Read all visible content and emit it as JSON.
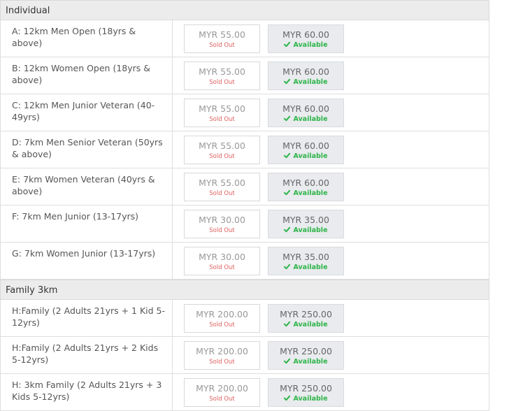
{
  "sections": [
    {
      "title": "Individual",
      "rows": [
        {
          "label": "A: 12km Men Open (18yrs & above)",
          "sold_price": "MYR 55.00",
          "sold_status": "Sold Out",
          "avail_price": "MYR 60.00",
          "avail_status": "Available"
        },
        {
          "label": "B: 12km Women Open (18yrs & above)",
          "sold_price": "MYR 55.00",
          "sold_status": "Sold Out",
          "avail_price": "MYR 60.00",
          "avail_status": "Available"
        },
        {
          "label": "C: 12km Men Junior Veteran (40-49yrs)",
          "sold_price": "MYR 55.00",
          "sold_status": "Sold Out",
          "avail_price": "MYR 60.00",
          "avail_status": "Available"
        },
        {
          "label": "D: 7km Men Senior Veteran (50yrs & above)",
          "sold_price": "MYR 55.00",
          "sold_status": "Sold Out",
          "avail_price": "MYR 60.00",
          "avail_status": "Available"
        },
        {
          "label": "E: 7km Women Veteran (40yrs & above)",
          "sold_price": "MYR 55.00",
          "sold_status": "Sold Out",
          "avail_price": "MYR 60.00",
          "avail_status": "Available"
        },
        {
          "label": "F: 7km Men Junior (13-17yrs)",
          "sold_price": "MYR 30.00",
          "sold_status": "Sold Out",
          "avail_price": "MYR 35.00",
          "avail_status": "Available"
        },
        {
          "label": "G: 7km Women Junior (13-17yrs)",
          "sold_price": "MYR 30.00",
          "sold_status": "Sold Out",
          "avail_price": "MYR 35.00",
          "avail_status": "Available"
        }
      ]
    },
    {
      "title": "Family 3km",
      "rows": [
        {
          "label": "H:Family (2 Adults 21yrs + 1 Kid 5-12yrs)",
          "sold_price": "MYR 200.00",
          "sold_status": "Sold Out",
          "avail_price": "MYR 250.00",
          "avail_status": "Available"
        },
        {
          "label": "H:Family (2 Adults 21yrs + 2 Kids 5-12yrs)",
          "sold_price": "MYR 200.00",
          "sold_status": "Sold Out",
          "avail_price": "MYR 250.00",
          "avail_status": "Available"
        },
        {
          "label": "H: 3km Family (2 Adults 21yrs + 3 Kids 5-12yrs)",
          "sold_price": "MYR 200.00",
          "sold_status": "Sold Out",
          "avail_price": "MYR 250.00",
          "avail_status": "Available"
        }
      ]
    }
  ],
  "icons": {
    "available": "check-icon"
  },
  "colors": {
    "sold_out": "#e06060",
    "available": "#2fb54a",
    "header_bg": "#ececec",
    "available_box_bg": "#e9ebee"
  }
}
